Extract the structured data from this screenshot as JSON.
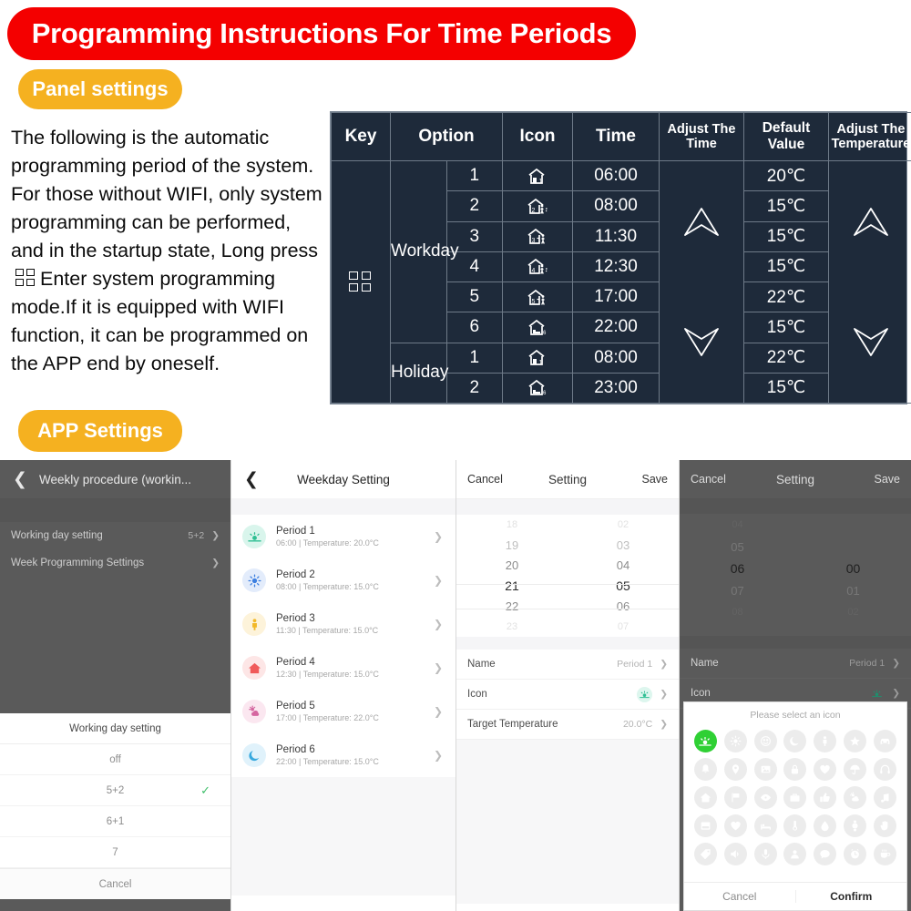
{
  "header": {
    "title": "Programming Instructions For Time Periods",
    "title_bg": "#f40000",
    "pill_panel": "Panel settings",
    "pill_app": "APP Settings",
    "pill_bg": "#f5b120"
  },
  "intro": {
    "part1": "The following is the automatic programming period of the system. For those without WIFI, only system programming can be performed, and in the startup state, Long press",
    "part2": "Enter system programming mode.If it is equipped with WIFI function, it can be programmed on the APP end by oneself."
  },
  "panel_table": {
    "bg": "#1e2a3a",
    "headers": {
      "key": "Key",
      "option": "Option",
      "icon": "Icon",
      "time": "Time",
      "adjust_time": "Adjust The Time",
      "default_value": "Default Value",
      "adjust_temperature": "Adjust The Temperature"
    },
    "groups": [
      {
        "name": "Workday",
        "rows": [
          {
            "num": "1",
            "icon": "house-sun-icon",
            "time": "06:00",
            "temp": "20℃"
          },
          {
            "num": "2",
            "icon": "house-leave-icon",
            "time": "08:00",
            "temp": "15℃"
          },
          {
            "num": "3",
            "icon": "house-return-icon",
            "time": "11:30",
            "temp": "15℃"
          },
          {
            "num": "4",
            "icon": "house-leave-icon",
            "time": "12:30",
            "temp": "15℃"
          },
          {
            "num": "5",
            "icon": "house-return-icon",
            "time": "17:00",
            "temp": "22℃"
          },
          {
            "num": "6",
            "icon": "house-bed-icon",
            "time": "22:00",
            "temp": "15℃"
          }
        ]
      },
      {
        "name": "Holiday",
        "rows": [
          {
            "num": "1",
            "icon": "house-sun-icon",
            "time": "08:00",
            "temp": "22℃"
          },
          {
            "num": "2",
            "icon": "house-bed-icon",
            "time": "23:00",
            "temp": "15℃"
          }
        ]
      }
    ]
  },
  "phone1": {
    "nav_title": "Weekly procedure (workin...",
    "rows": [
      {
        "label": "Working day setting",
        "value": "5+2"
      },
      {
        "label": "Week Programming Settings",
        "value": ""
      }
    ],
    "sheet": {
      "title": "Working day setting",
      "options": [
        {
          "label": "off",
          "checked": false
        },
        {
          "label": "5+2",
          "checked": true
        },
        {
          "label": "6+1",
          "checked": false
        },
        {
          "label": "7",
          "checked": false
        }
      ],
      "cancel": "Cancel",
      "check_color": "#3fbf6a"
    }
  },
  "phone2": {
    "nav_title": "Weekday Setting",
    "periods": [
      {
        "name": "Period 1",
        "detail": "06:00  |  Temperature: 20.0°C",
        "icon": "sunrise-icon",
        "badge_bg": "#d9f5ec",
        "glyph_color": "#2fbf93"
      },
      {
        "name": "Period 2",
        "detail": "08:00  |  Temperature: 15.0°C",
        "icon": "sun-icon",
        "badge_bg": "#e3ecfb",
        "glyph_color": "#3d7fe0"
      },
      {
        "name": "Period 3",
        "detail": "11:30  |  Temperature: 15.0°C",
        "icon": "person-icon",
        "badge_bg": "#fdf3da",
        "glyph_color": "#f2b827"
      },
      {
        "name": "Period 4",
        "detail": "12:30  |  Temperature: 15.0°C",
        "icon": "home-icon",
        "badge_bg": "#fde6e6",
        "glyph_color": "#f05a5a"
      },
      {
        "name": "Period 5",
        "detail": "17:00  |  Temperature: 22.0°C",
        "icon": "sun-cloud-icon",
        "badge_bg": "#fbe7f0",
        "glyph_color": "#d566a0"
      },
      {
        "name": "Period 6",
        "detail": "22:00  |  Temperature: 15.0°C",
        "icon": "moon-icon",
        "badge_bg": "#e0f2fb",
        "glyph_color": "#38a9de"
      }
    ]
  },
  "phone3": {
    "nav_left": "Cancel",
    "nav_title": "Setting",
    "nav_right": "Save",
    "hours": [
      "18",
      "19",
      "20",
      "21",
      "22",
      "23"
    ],
    "minutes": [
      "02",
      "03",
      "04",
      "05",
      "06",
      "07"
    ],
    "selected_hour": "21",
    "selected_minute": "05",
    "fields": [
      {
        "label": "Name",
        "value": "Period 1"
      },
      {
        "label": "Icon",
        "value": ""
      },
      {
        "label": "Target Temperature",
        "value": "20.0°C"
      }
    ]
  },
  "phone4": {
    "nav_left": "Cancel",
    "nav_title": "Setting",
    "nav_right": "Save",
    "hours": [
      "04",
      "05",
      "06",
      "07",
      "08"
    ],
    "minutes": [
      "00",
      "01",
      "02"
    ],
    "selected_hour": "06",
    "selected_minute": "00",
    "fields": [
      {
        "label": "Name",
        "value": "Period 1"
      },
      {
        "label": "Icon",
        "value": ""
      }
    ],
    "icon_sheet": {
      "title": "Please select an icon",
      "cancel": "Cancel",
      "confirm": "Confirm",
      "selected_color": "#2fd034",
      "icons": [
        "sunrise-icon",
        "sun-icon",
        "smiley-icon",
        "moon-icon",
        "person-icon",
        "star-icon",
        "car-icon",
        "bell-icon",
        "location-pin-icon",
        "image-icon",
        "lock-icon",
        "heart-outline-icon",
        "umbrella-icon",
        "headphones-icon",
        "home-icon",
        "flag-icon",
        "eye-icon",
        "briefcase-icon",
        "thumbs-up-icon",
        "sun-cloud-icon",
        "music-note-icon",
        "book-icon",
        "heart-icon",
        "bed-icon",
        "thermometer-icon",
        "water-drop-icon",
        "watch-icon",
        "hand-icon",
        "tag-icon",
        "speaker-icon",
        "microphone-icon",
        "upload-icon",
        "chat-bubble-icon",
        "alarm-clock-icon",
        "coffee-cup-icon"
      ]
    }
  }
}
